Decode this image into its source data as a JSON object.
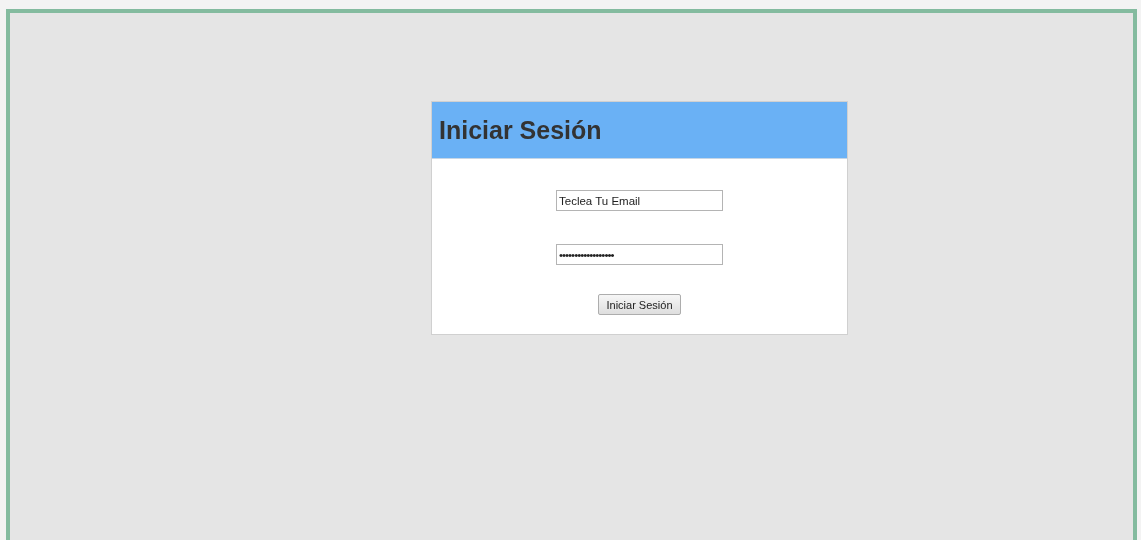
{
  "login": {
    "title": "Iniciar Sesión",
    "email": {
      "value": "Teclea Tu Email"
    },
    "password": {
      "value": "••••••••••••••••••"
    },
    "submit": {
      "label": "Iniciar Sesión"
    }
  }
}
